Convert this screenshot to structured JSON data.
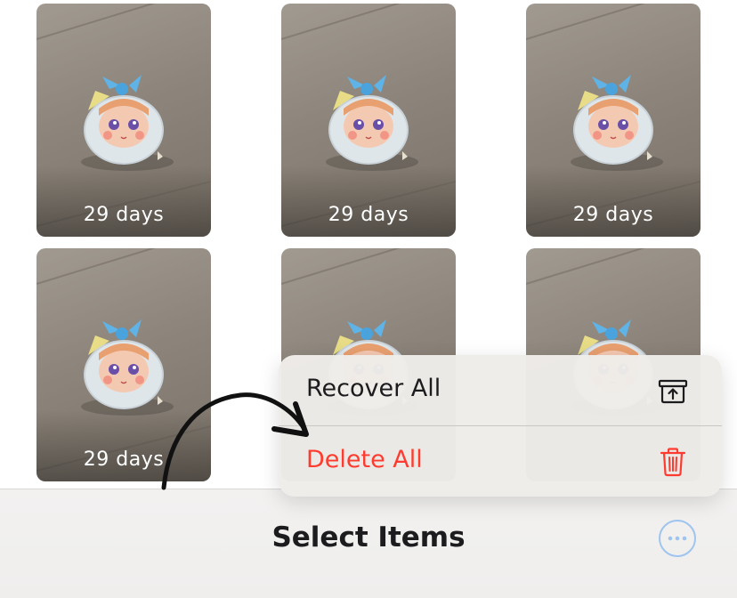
{
  "tiles": [
    {
      "days": "29 days"
    },
    {
      "days": "29 days"
    },
    {
      "days": "29 days"
    },
    {
      "days": "29 days"
    },
    {
      "days": ""
    },
    {
      "days": ""
    }
  ],
  "menu": {
    "recover_label": "Recover All",
    "recover_icon": "archive-restore-icon",
    "delete_label": "Delete All",
    "delete_icon": "trash-icon"
  },
  "bottom_bar": {
    "title": "Select Items",
    "more_icon": "ellipsis-circle-icon"
  },
  "colors": {
    "delete": "#ff3b30",
    "accent": "#9fc4f0",
    "text": "#1c1c1e"
  }
}
